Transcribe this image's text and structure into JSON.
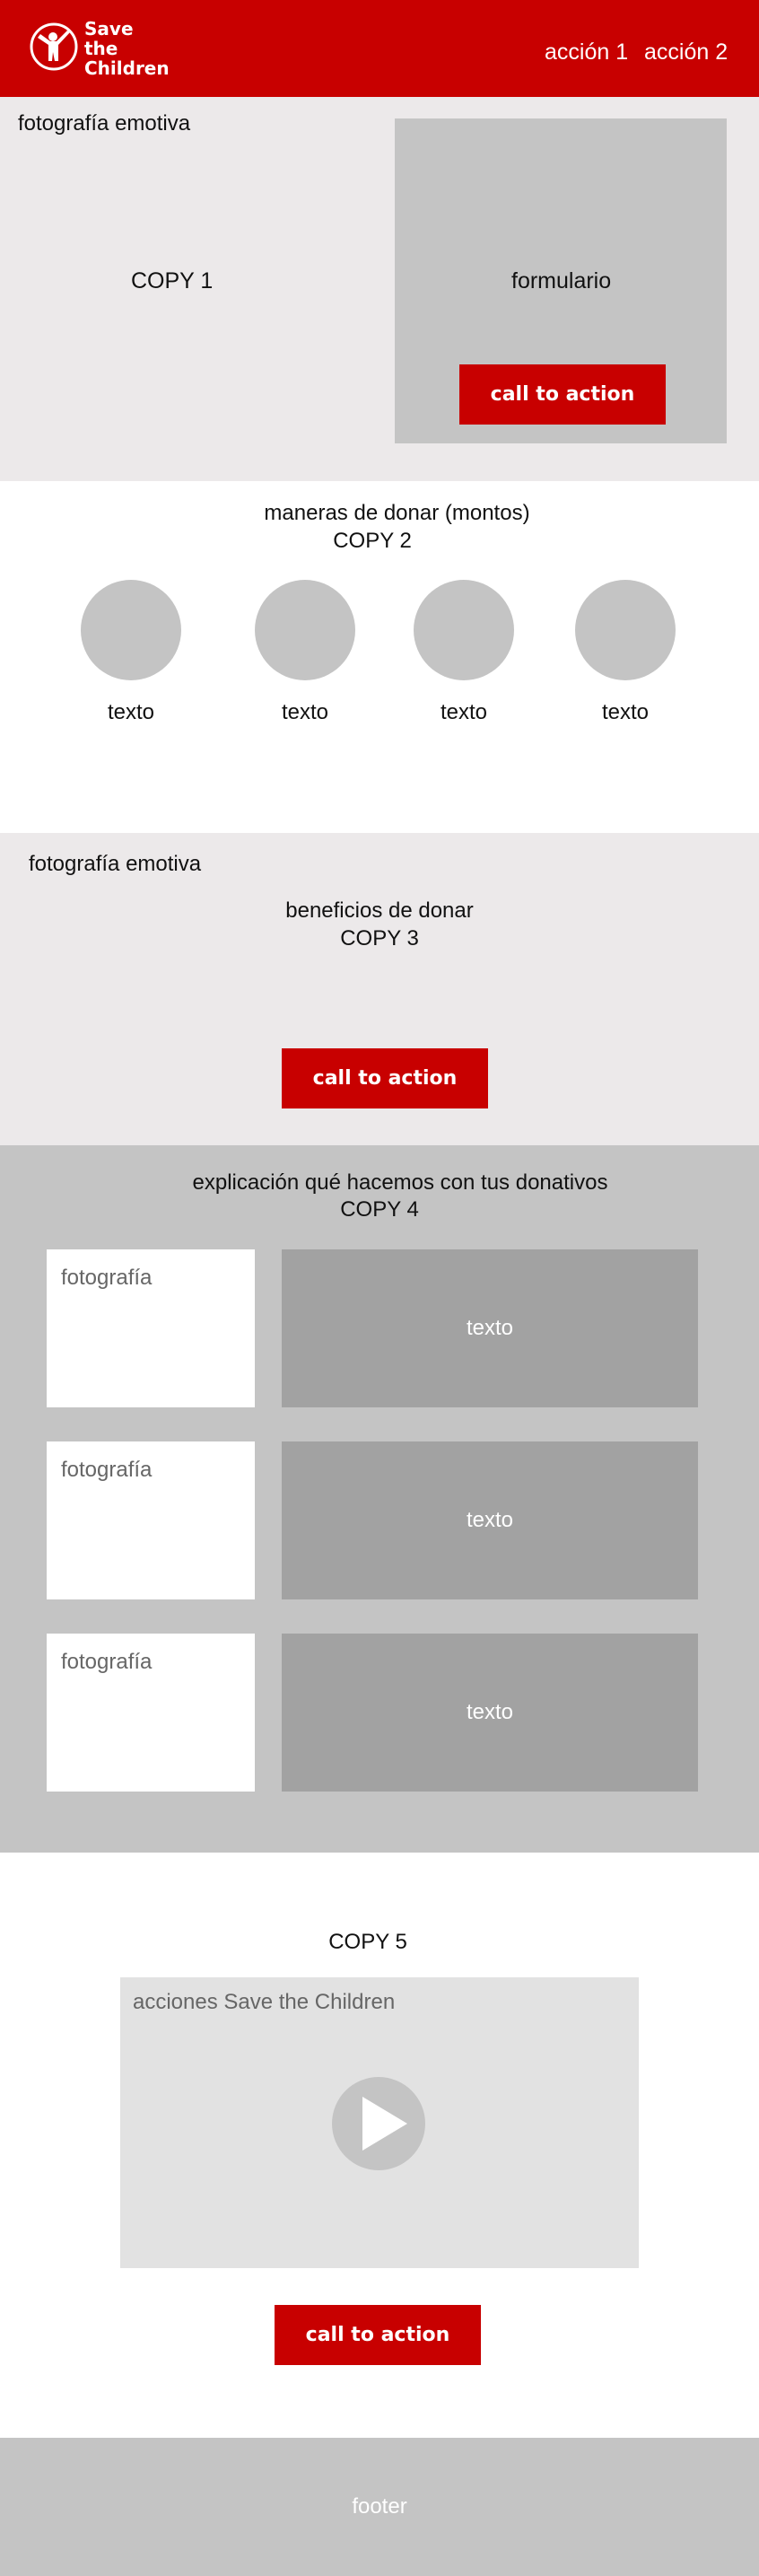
{
  "header": {
    "brand_line1": "Save the",
    "brand_line2": "Children",
    "logo_icon": "child-figure-icon",
    "nav": [
      "acción 1",
      "acción 2"
    ]
  },
  "hero": {
    "photo_label": "fotografía emotiva",
    "copy": "COPY 1",
    "form_label": "formulario",
    "cta": "call to action"
  },
  "donate": {
    "title": "maneras de donar (montos)",
    "copy": "COPY 2",
    "options": [
      {
        "label": "texto"
      },
      {
        "label": "texto"
      },
      {
        "label": "texto"
      },
      {
        "label": "texto"
      }
    ]
  },
  "benefits": {
    "photo_label": "fotografía emotiva",
    "title": "beneficios de donar",
    "copy": "COPY 3",
    "cta": "call to action"
  },
  "explain": {
    "title": "explicación qué hacemos con tus donativos",
    "copy": "COPY 4",
    "rows": [
      {
        "photo": "fotografía",
        "text": "texto"
      },
      {
        "photo": "fotografía",
        "text": "texto"
      },
      {
        "photo": "fotografía",
        "text": "texto"
      }
    ]
  },
  "video_section": {
    "copy": "COPY 5",
    "video_label": "acciones Save the Children",
    "play_icon": "play-icon",
    "cta": "call to action"
  },
  "footer": {
    "label": "footer"
  },
  "colors": {
    "brand_red": "#c80000",
    "light_gray": "#ece9ea",
    "mid_gray": "#c4c4c4",
    "dark_gray": "#a2a2a2"
  }
}
